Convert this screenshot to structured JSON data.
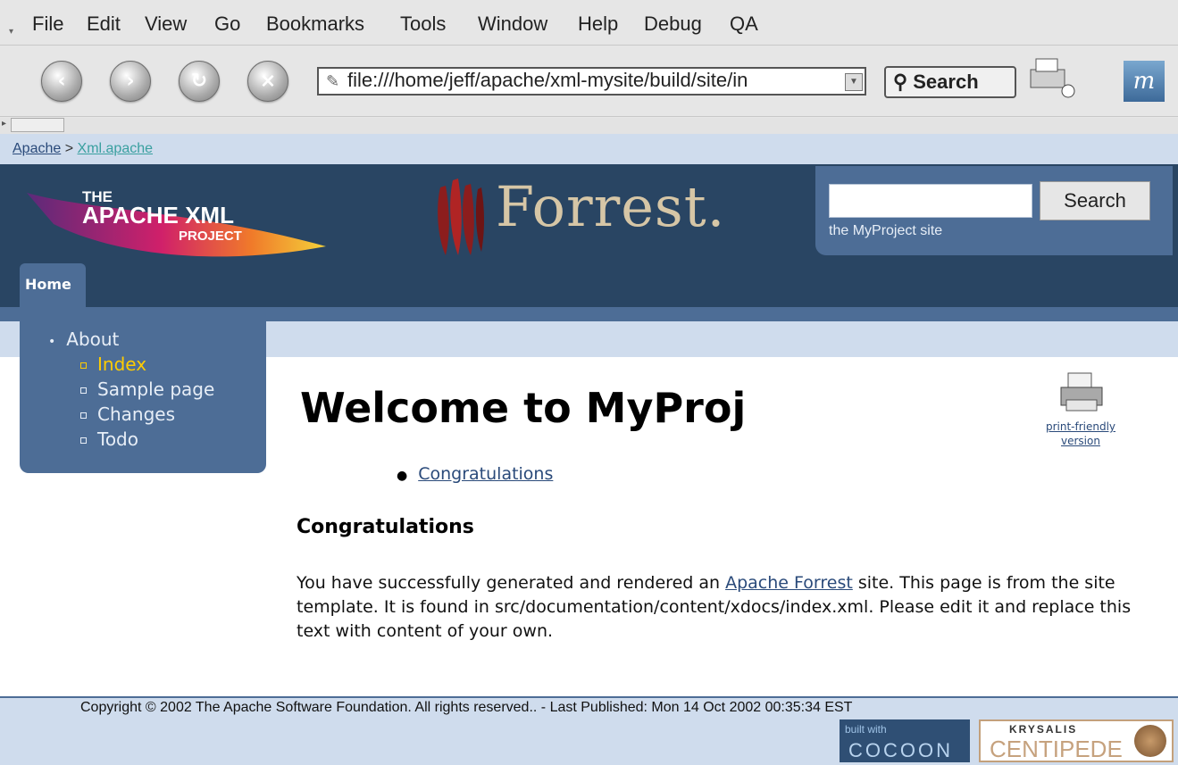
{
  "browser": {
    "menu": [
      "File",
      "Edit",
      "View",
      "Go",
      "Bookmarks",
      "Tools",
      "Window",
      "Help",
      "Debug",
      "QA"
    ],
    "url": "file:///home/jeff/apache/xml-mysite/build/site/in",
    "search_button": "Search",
    "icons": [
      "back-icon",
      "forward-icon",
      "reload-icon",
      "stop-icon",
      "print-icon",
      "mozilla-logo"
    ]
  },
  "breadcrumb": {
    "item1": "Apache",
    "separator": ">",
    "item2": "Xml.apache"
  },
  "header": {
    "logo_line1": "THE",
    "logo_line2": "APACHE XML",
    "logo_line3": "PROJECT",
    "forrest_label": "Forrest.",
    "search_button": "Search",
    "search_caption": "the MyProject site",
    "home_tab": "Home"
  },
  "sidebar": {
    "group": "About",
    "items": [
      {
        "label": "Index",
        "current": true
      },
      {
        "label": "Sample page",
        "current": false
      },
      {
        "label": "Changes",
        "current": false
      },
      {
        "label": "Todo",
        "current": false
      }
    ]
  },
  "content": {
    "title": "Welcome to MyProj",
    "print_link": "print-friendly version",
    "toc_item": "Congratulations",
    "section_heading": "Congratulations",
    "para_part1": "You have successfully generated and rendered an ",
    "para_link": "Apache Forrest",
    "para_part2": " site. This page is from the site template. It is found in src/documentation/content/xdocs/index.xml. Please edit it and replace this text with content of your own."
  },
  "footer": {
    "copyright": "Copyright © 2002 The Apache Software Foundation. All rights reserved.. - Last Published: Mon 14 Oct 2002 00:35:34 EST",
    "cocoon_line1": "built with",
    "cocoon_line2": "COCOON",
    "krysalis_line1": "KRYSALIS",
    "krysalis_line2": "CENTIPEDE"
  },
  "colors": {
    "header_bg": "#294563",
    "panel_bg": "#4d6d96",
    "light_bar": "#cfdced",
    "current_item": "#ffcc00"
  }
}
